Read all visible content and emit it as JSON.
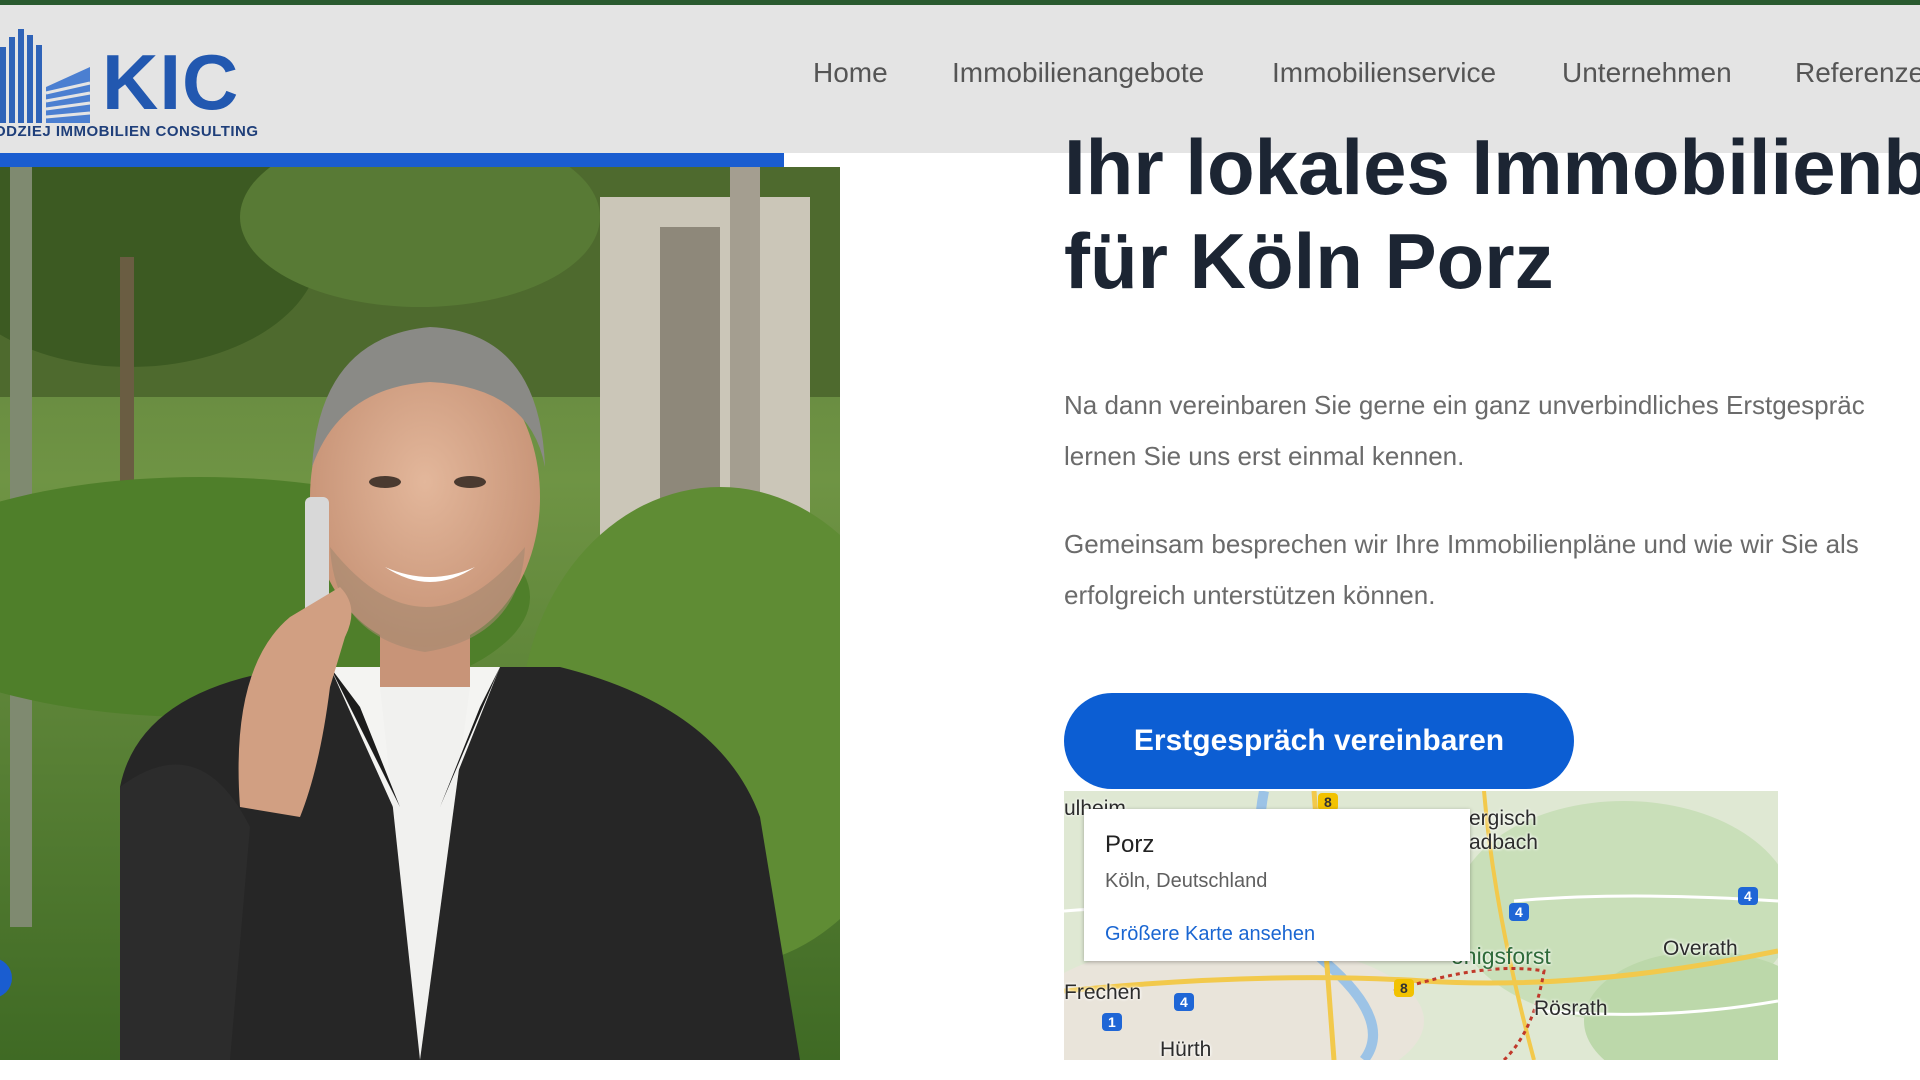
{
  "header": {
    "logo": {
      "mark": "KIC",
      "subtitle": "ODZIEJ IMMOBILIEN CONSULTING"
    },
    "nav": [
      {
        "label": "Home"
      },
      {
        "label": "Immobilienangebote"
      },
      {
        "label": "Immobilienservice"
      },
      {
        "label": "Unternehmen"
      },
      {
        "label": "Referenze"
      }
    ]
  },
  "hero": {
    "photo_alt": "Smiling man in a dark suit talking on a mobile phone outdoors",
    "headline_line1": "Ihr lokales Immobilienbu",
    "headline_line2": "für Köln Porz",
    "paragraph1_line1": "Na dann vereinbaren Sie gerne ein ganz unverbindliches Erstgespräc",
    "paragraph1_line2": "lernen Sie uns erst einmal kennen.",
    "paragraph2_line1": "Gemeinsam besprechen wir Ihre Immobilienpläne und wie wir Sie als",
    "paragraph2_line2": "erfolgreich unterstützen können.",
    "cta_label": "Erstgespräch vereinbaren"
  },
  "map": {
    "card_title": "Porz",
    "card_subtitle": "Köln, Deutschland",
    "card_link": "Größere Karte ansehen",
    "labels": {
      "top_left": "ulheim",
      "bergisch_1": "ergisch",
      "bergisch_2": "adbach",
      "koenigsforst": "önigsforst",
      "overath": "Overath",
      "frechen": "Frechen",
      "roesrath": "Rösrath",
      "huerth": "Hürth"
    },
    "shields": [
      "8",
      "4",
      "4",
      "4",
      "8",
      "1"
    ]
  },
  "colors": {
    "accent_blue": "#0c5ed3",
    "header_bg": "#e4e4e4",
    "headline": "#1c2533",
    "body_text": "#6b6b6b",
    "top_accent": "#2a5a2f"
  }
}
